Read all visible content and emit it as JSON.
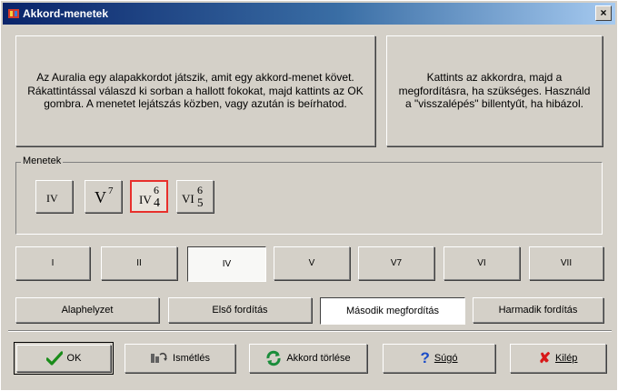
{
  "window": {
    "title": "Akkord-menetek",
    "close_glyph": "×"
  },
  "instructions": {
    "main": "Az Auralia egy alapakkordot játszik, amit egy akkord-menet követ.  Rákattintással válaszd ki sorban a hallott fokokat, majd kattints az OK gombra. A menetet lejátszás közben, vagy azután is beírhatod.",
    "hint": "Kattints az akkordra, majd a megfordításra, ha szükséges. Használd a \"visszalépés\" billentyűt, ha hibázol."
  },
  "progression": {
    "label": "Menetek",
    "chords": [
      {
        "roman": "IV",
        "sup": "",
        "sub": "",
        "selected": false
      },
      {
        "roman": "V",
        "sup": "7",
        "sub": "",
        "selected": false
      },
      {
        "roman": "IV",
        "sup": "6",
        "sub": "4",
        "selected": true
      },
      {
        "roman": "VI",
        "sup": "6",
        "sub": "5",
        "selected": false
      }
    ]
  },
  "degrees": [
    {
      "label": "I",
      "pressed": false
    },
    {
      "label": "II",
      "pressed": false
    },
    {
      "label": "IV",
      "pressed": true
    },
    {
      "label": "V",
      "pressed": false
    },
    {
      "label": "V7",
      "pressed": false
    },
    {
      "label": "VI",
      "pressed": false
    },
    {
      "label": "VII",
      "pressed": false
    }
  ],
  "inversions": [
    {
      "label": "Alaphelyzet",
      "pressed": false
    },
    {
      "label": "Első fordítás",
      "pressed": false
    },
    {
      "label": "Második megfordítás",
      "pressed": true
    },
    {
      "label": "Harmadik fordítás",
      "pressed": false
    }
  ],
  "actions": {
    "ok": "OK",
    "repeat": "Ismétlés",
    "clear": "Akkord törlése",
    "help": "Súgó",
    "exit": "Kilép"
  },
  "colors": {
    "selected_border": "#e8302c",
    "ok_check": "#1a8c1a",
    "exit_x": "#d81818",
    "help_q": "#1a4cc8"
  },
  "icons": {
    "ok": "checkmark-icon",
    "repeat": "repeat-icon",
    "clear": "refresh-icon",
    "help": "question-icon",
    "exit": "x-icon"
  }
}
